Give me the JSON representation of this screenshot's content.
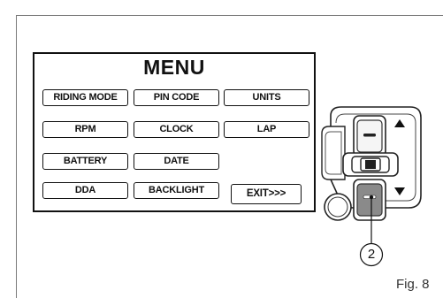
{
  "menu": {
    "title": "MENU",
    "items": [
      {
        "label": "RIDING MODE"
      },
      {
        "label": "PIN CODE"
      },
      {
        "label": "UNITS"
      },
      {
        "label": "RPM"
      },
      {
        "label": "CLOCK"
      },
      {
        "label": "LAP"
      },
      {
        "label": "BATTERY"
      },
      {
        "label": "DATE"
      },
      {
        "label": "DDA"
      },
      {
        "label": "BACKLIGHT"
      }
    ],
    "exit_label": "EXIT>>>"
  },
  "device": {
    "up_arrow_icon": "triangle-up",
    "down_arrow_icon": "triangle-down",
    "callout_number": "2"
  },
  "figure": {
    "label": "Fig. 8"
  }
}
